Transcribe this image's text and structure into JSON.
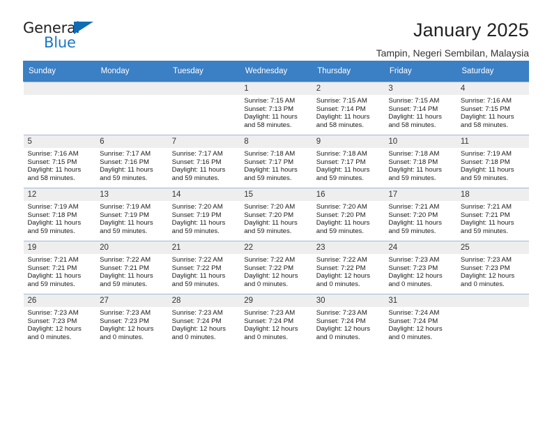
{
  "brand": {
    "name_part1": "General",
    "name_part2": "Blue",
    "accent_color": "#1878c4",
    "triangle_color": "#0f6cb5"
  },
  "header": {
    "title": "January 2025",
    "subtitle": "Tampin, Negeri Sembilan, Malaysia"
  },
  "calendar": {
    "header_bg": "#3b7fc4",
    "weekday_headers": [
      "Sunday",
      "Monday",
      "Tuesday",
      "Wednesday",
      "Thursday",
      "Friday",
      "Saturday"
    ],
    "weeks": [
      [
        {
          "day": "",
          "sunrise": "",
          "sunset": "",
          "daylight1": "",
          "daylight2": ""
        },
        {
          "day": "",
          "sunrise": "",
          "sunset": "",
          "daylight1": "",
          "daylight2": ""
        },
        {
          "day": "",
          "sunrise": "",
          "sunset": "",
          "daylight1": "",
          "daylight2": ""
        },
        {
          "day": "1",
          "sunrise": "Sunrise: 7:15 AM",
          "sunset": "Sunset: 7:13 PM",
          "daylight1": "Daylight: 11 hours",
          "daylight2": "and 58 minutes."
        },
        {
          "day": "2",
          "sunrise": "Sunrise: 7:15 AM",
          "sunset": "Sunset: 7:14 PM",
          "daylight1": "Daylight: 11 hours",
          "daylight2": "and 58 minutes."
        },
        {
          "day": "3",
          "sunrise": "Sunrise: 7:15 AM",
          "sunset": "Sunset: 7:14 PM",
          "daylight1": "Daylight: 11 hours",
          "daylight2": "and 58 minutes."
        },
        {
          "day": "4",
          "sunrise": "Sunrise: 7:16 AM",
          "sunset": "Sunset: 7:15 PM",
          "daylight1": "Daylight: 11 hours",
          "daylight2": "and 58 minutes."
        }
      ],
      [
        {
          "day": "5",
          "sunrise": "Sunrise: 7:16 AM",
          "sunset": "Sunset: 7:15 PM",
          "daylight1": "Daylight: 11 hours",
          "daylight2": "and 58 minutes."
        },
        {
          "day": "6",
          "sunrise": "Sunrise: 7:17 AM",
          "sunset": "Sunset: 7:16 PM",
          "daylight1": "Daylight: 11 hours",
          "daylight2": "and 59 minutes."
        },
        {
          "day": "7",
          "sunrise": "Sunrise: 7:17 AM",
          "sunset": "Sunset: 7:16 PM",
          "daylight1": "Daylight: 11 hours",
          "daylight2": "and 59 minutes."
        },
        {
          "day": "8",
          "sunrise": "Sunrise: 7:18 AM",
          "sunset": "Sunset: 7:17 PM",
          "daylight1": "Daylight: 11 hours",
          "daylight2": "and 59 minutes."
        },
        {
          "day": "9",
          "sunrise": "Sunrise: 7:18 AM",
          "sunset": "Sunset: 7:17 PM",
          "daylight1": "Daylight: 11 hours",
          "daylight2": "and 59 minutes."
        },
        {
          "day": "10",
          "sunrise": "Sunrise: 7:18 AM",
          "sunset": "Sunset: 7:18 PM",
          "daylight1": "Daylight: 11 hours",
          "daylight2": "and 59 minutes."
        },
        {
          "day": "11",
          "sunrise": "Sunrise: 7:19 AM",
          "sunset": "Sunset: 7:18 PM",
          "daylight1": "Daylight: 11 hours",
          "daylight2": "and 59 minutes."
        }
      ],
      [
        {
          "day": "12",
          "sunrise": "Sunrise: 7:19 AM",
          "sunset": "Sunset: 7:18 PM",
          "daylight1": "Daylight: 11 hours",
          "daylight2": "and 59 minutes."
        },
        {
          "day": "13",
          "sunrise": "Sunrise: 7:19 AM",
          "sunset": "Sunset: 7:19 PM",
          "daylight1": "Daylight: 11 hours",
          "daylight2": "and 59 minutes."
        },
        {
          "day": "14",
          "sunrise": "Sunrise: 7:20 AM",
          "sunset": "Sunset: 7:19 PM",
          "daylight1": "Daylight: 11 hours",
          "daylight2": "and 59 minutes."
        },
        {
          "day": "15",
          "sunrise": "Sunrise: 7:20 AM",
          "sunset": "Sunset: 7:20 PM",
          "daylight1": "Daylight: 11 hours",
          "daylight2": "and 59 minutes."
        },
        {
          "day": "16",
          "sunrise": "Sunrise: 7:20 AM",
          "sunset": "Sunset: 7:20 PM",
          "daylight1": "Daylight: 11 hours",
          "daylight2": "and 59 minutes."
        },
        {
          "day": "17",
          "sunrise": "Sunrise: 7:21 AM",
          "sunset": "Sunset: 7:20 PM",
          "daylight1": "Daylight: 11 hours",
          "daylight2": "and 59 minutes."
        },
        {
          "day": "18",
          "sunrise": "Sunrise: 7:21 AM",
          "sunset": "Sunset: 7:21 PM",
          "daylight1": "Daylight: 11 hours",
          "daylight2": "and 59 minutes."
        }
      ],
      [
        {
          "day": "19",
          "sunrise": "Sunrise: 7:21 AM",
          "sunset": "Sunset: 7:21 PM",
          "daylight1": "Daylight: 11 hours",
          "daylight2": "and 59 minutes."
        },
        {
          "day": "20",
          "sunrise": "Sunrise: 7:22 AM",
          "sunset": "Sunset: 7:21 PM",
          "daylight1": "Daylight: 11 hours",
          "daylight2": "and 59 minutes."
        },
        {
          "day": "21",
          "sunrise": "Sunrise: 7:22 AM",
          "sunset": "Sunset: 7:22 PM",
          "daylight1": "Daylight: 11 hours",
          "daylight2": "and 59 minutes."
        },
        {
          "day": "22",
          "sunrise": "Sunrise: 7:22 AM",
          "sunset": "Sunset: 7:22 PM",
          "daylight1": "Daylight: 12 hours",
          "daylight2": "and 0 minutes."
        },
        {
          "day": "23",
          "sunrise": "Sunrise: 7:22 AM",
          "sunset": "Sunset: 7:22 PM",
          "daylight1": "Daylight: 12 hours",
          "daylight2": "and 0 minutes."
        },
        {
          "day": "24",
          "sunrise": "Sunrise: 7:23 AM",
          "sunset": "Sunset: 7:23 PM",
          "daylight1": "Daylight: 12 hours",
          "daylight2": "and 0 minutes."
        },
        {
          "day": "25",
          "sunrise": "Sunrise: 7:23 AM",
          "sunset": "Sunset: 7:23 PM",
          "daylight1": "Daylight: 12 hours",
          "daylight2": "and 0 minutes."
        }
      ],
      [
        {
          "day": "26",
          "sunrise": "Sunrise: 7:23 AM",
          "sunset": "Sunset: 7:23 PM",
          "daylight1": "Daylight: 12 hours",
          "daylight2": "and 0 minutes."
        },
        {
          "day": "27",
          "sunrise": "Sunrise: 7:23 AM",
          "sunset": "Sunset: 7:23 PM",
          "daylight1": "Daylight: 12 hours",
          "daylight2": "and 0 minutes."
        },
        {
          "day": "28",
          "sunrise": "Sunrise: 7:23 AM",
          "sunset": "Sunset: 7:24 PM",
          "daylight1": "Daylight: 12 hours",
          "daylight2": "and 0 minutes."
        },
        {
          "day": "29",
          "sunrise": "Sunrise: 7:23 AM",
          "sunset": "Sunset: 7:24 PM",
          "daylight1": "Daylight: 12 hours",
          "daylight2": "and 0 minutes."
        },
        {
          "day": "30",
          "sunrise": "Sunrise: 7:23 AM",
          "sunset": "Sunset: 7:24 PM",
          "daylight1": "Daylight: 12 hours",
          "daylight2": "and 0 minutes."
        },
        {
          "day": "31",
          "sunrise": "Sunrise: 7:24 AM",
          "sunset": "Sunset: 7:24 PM",
          "daylight1": "Daylight: 12 hours",
          "daylight2": "and 0 minutes."
        },
        {
          "day": "",
          "sunrise": "",
          "sunset": "",
          "daylight1": "",
          "daylight2": ""
        }
      ]
    ]
  }
}
